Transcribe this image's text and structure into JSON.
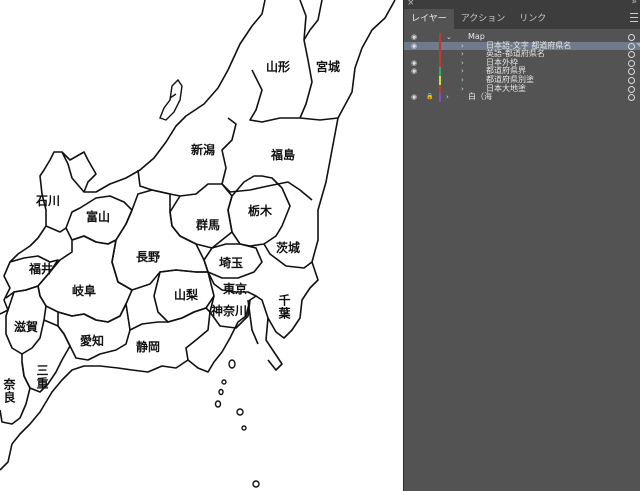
{
  "panel": {
    "tabs": [
      "レイヤー",
      "アクション",
      "リンク"
    ],
    "layers": [
      {
        "name": "Map",
        "visible": true,
        "locked": false,
        "expanded": true,
        "color": "#c0392b",
        "level": 0
      },
      {
        "name": "日本語-文字 都道府県名",
        "visible": true,
        "locked": false,
        "expanded": false,
        "color": "#c0392b",
        "level": 1,
        "selected": true
      },
      {
        "name": "英語-都道府県名",
        "visible": false,
        "locked": false,
        "expanded": false,
        "color": "#c0392b",
        "level": 1
      },
      {
        "name": "日本外枠",
        "visible": true,
        "locked": false,
        "expanded": false,
        "color": "#c0392b",
        "level": 1
      },
      {
        "name": "都道府県界",
        "visible": true,
        "locked": false,
        "expanded": false,
        "color": "#27ae60",
        "level": 1
      },
      {
        "name": "都道府県別塗",
        "visible": false,
        "locked": false,
        "expanded": false,
        "color": "#c9e04a",
        "level": 1
      },
      {
        "name": "日本大地塗",
        "visible": false,
        "locked": false,
        "expanded": false,
        "color": "#c0392b",
        "level": 1
      },
      {
        "name": "白（海",
        "visible": true,
        "locked": true,
        "expanded": false,
        "color": "#7b4fc9",
        "level": 0
      }
    ]
  },
  "map": {
    "labels": [
      "山形",
      "宮城",
      "新潟",
      "福島",
      "石川",
      "富山",
      "栃木",
      "群馬",
      "茨城",
      "長野",
      "埼玉",
      "福井",
      "岐阜",
      "東京",
      "山梨",
      "千葉",
      "神奈川",
      "滋賀",
      "愛知",
      "静岡",
      "三重",
      "奈良"
    ]
  }
}
